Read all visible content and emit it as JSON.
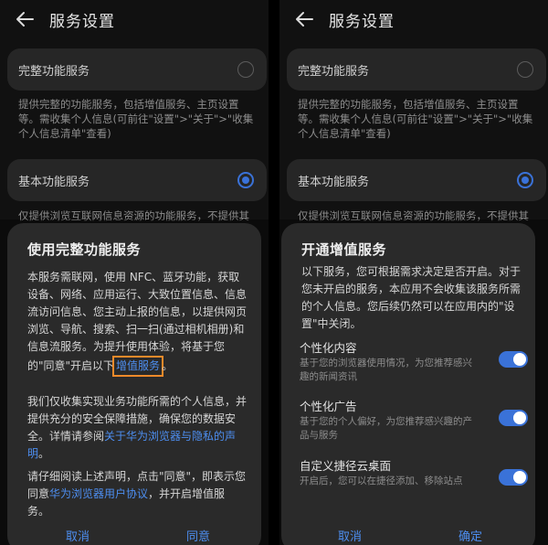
{
  "left": {
    "header": {
      "title": "服务设置"
    },
    "full_service": {
      "label": "完整功能服务",
      "desc": "提供完整的功能服务，包括增值服务、主页设置等。需收集个人信息(可前往\"设置\">\"关于\">\"收集个人信息清单\"查看)"
    },
    "basic_service": {
      "label": "基本功能服务",
      "desc": "仅提供浏览互联网信息资源的功能服务，不提供其"
    },
    "dialog": {
      "title": "使用完整功能服务",
      "p1_text": "本服务需联网，使用 NFC、蓝牙功能，获取设备、网络、应用运行、大致位置信息、信息流访问信息、您主动上报的信息，以提供网页浏览、导航、搜索、扫一扫(通过相机相册)和信息流服务。为提升使用体验，将基于您的\"同意\"开启以下",
      "p1_link": "增值服务",
      "p1_end": "。",
      "p2_text": "我们仅收集实现业务功能所需的个人信息，并提供充分的安全保障措施，确保您的数据安全。详情请参阅",
      "p2_link": "关于华为浏览器与隐私的声明",
      "p2_end": "。",
      "p3_text": "请仔细阅读上述声明，点击\"同意\"，即表示您同意",
      "p3_link": "华为浏览器用户协议",
      "p3_end": "，并开启增值服务。",
      "cancel": "取消",
      "agree": "同意"
    }
  },
  "right": {
    "header": {
      "title": "服务设置"
    },
    "full_service": {
      "label": "完整功能服务",
      "desc": "提供完整的功能服务，包括增值服务、主页设置等。需收集个人信息(可前往\"设置\">\"关于\">\"收集个人信息清单\"查看)"
    },
    "basic_service": {
      "label": "基本功能服务",
      "desc": "仅提供浏览互联网信息资源的功能服务，不提供其"
    },
    "dialog": {
      "title": "开通增值服务",
      "intro": "以下服务，您可根据需求决定是否开启。对于您未开启的服务，本应用不会收集该服务所需的个人信息。您后续仍然可以在应用内的\"设置\"中关闭。",
      "items": [
        {
          "title": "个性化内容",
          "desc": "基于您的浏览器使用情况，为您推荐感兴趣的新闻资讯",
          "on": true
        },
        {
          "title": "个性化广告",
          "desc": "基于您的个人偏好，为您推荐感兴趣的产品与服务",
          "on": true
        },
        {
          "title": "自定义捷径云桌面",
          "desc": "开启后，您可以在捷径添加、移除站点",
          "on": true
        }
      ],
      "cancel": "取消",
      "confirm": "确定"
    }
  },
  "colors": {
    "accent": "#3a72d8",
    "link": "#4d8ef0",
    "highlight": "#f08a2a"
  }
}
